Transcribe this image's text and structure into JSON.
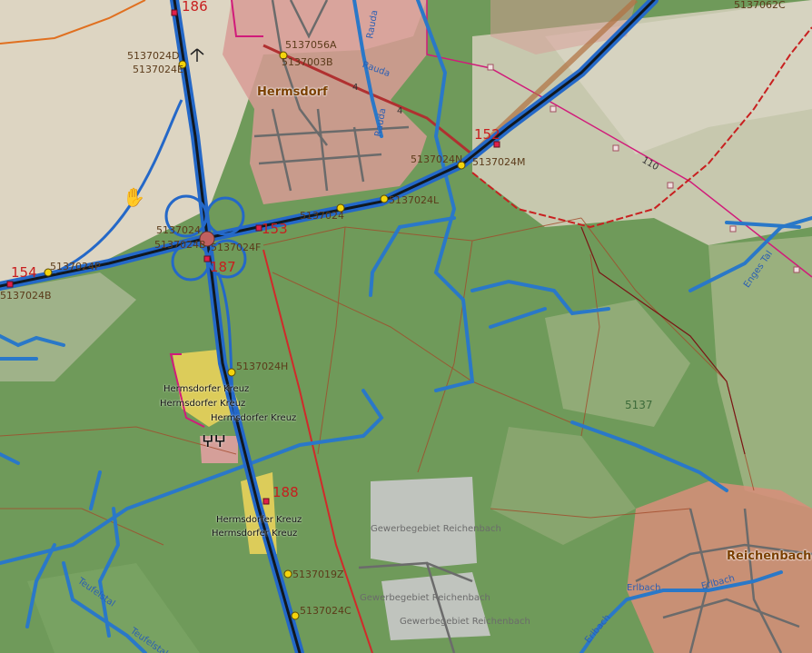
{
  "map": {
    "places": [
      {
        "key": "hermsdorf",
        "label": "Hermsdorf"
      },
      {
        "key": "reichenbach",
        "label": "Reichenbach"
      }
    ],
    "road_numbers": [
      "186",
      "153",
      "152",
      "154",
      "187",
      "188"
    ],
    "routes": [
      "110",
      "4",
      "4"
    ],
    "streets": [
      "Rauda",
      "Rauda",
      "Rauda",
      "Erlbach",
      "Erlbach",
      "Erlbach",
      "Teufelstal",
      "Teufelstal",
      "Enges Tal"
    ],
    "areas": [
      "Gewerbegebiet Reichenbach",
      "Gewerbegebiet Reichenbach",
      "Gewerbegebiet Reichenbach"
    ],
    "pois": [
      "Hermsdorfer Kreuz",
      "Hermsdorfer Kreuz",
      "Hermsdorfer Kreuz",
      "Hermsdorfer Kreuz",
      "Hermsdorfer Kreuz"
    ],
    "grid_labels": [
      "5137"
    ],
    "node_labels": [
      "5137024D",
      "5137024E",
      "5137056A",
      "5137003B",
      "5137024N",
      "5137024M",
      "5137024L",
      "5137024B",
      "5137024P",
      "5137024F",
      "5137024B",
      "5137024H",
      "5137019Z",
      "5137024C",
      "5137062C",
      "5137024",
      "5137024"
    ],
    "cursor_icon": "hand-cursor-icon",
    "colors": {
      "forest": "#6f9a5a",
      "field": "#d8d2c0",
      "motorway": "#2468c8",
      "motorway_core": "#101820",
      "railway": "#d12a2a",
      "river": "#2a78c8",
      "boundary": "#d11b7a",
      "settlement": "#d98a8a",
      "node_marker": "#f4d40c"
    }
  }
}
